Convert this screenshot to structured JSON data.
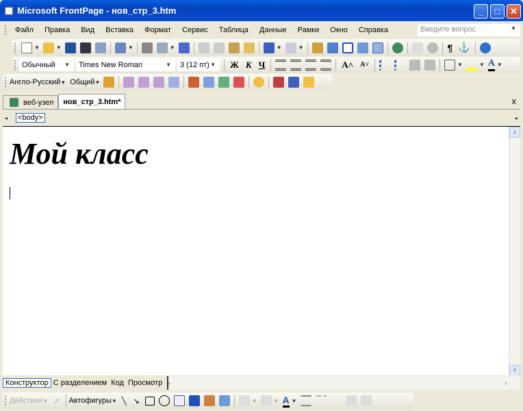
{
  "window": {
    "title": "Microsoft FrontPage - нов_стр_3.htm",
    "minimize": "_",
    "maximize": "□",
    "close": "✕"
  },
  "menu": {
    "items": [
      "Файл",
      "Правка",
      "Вид",
      "Вставка",
      "Формат",
      "Сервис",
      "Таблица",
      "Данные",
      "Рамки",
      "Окно",
      "Справка"
    ],
    "ask_placeholder": "Введите вопрос"
  },
  "formatting": {
    "style": "Обычный",
    "font": "Times New Roman",
    "size": "3 (12 пт)",
    "bold": "Ж",
    "italic": "К",
    "underline": "Ч"
  },
  "toolbar3": {
    "dictionary": "Англо-Русский",
    "general": "Общий"
  },
  "tabs": [
    {
      "label": "веб-узел"
    },
    {
      "label": "нов_стр_3.htm*"
    }
  ],
  "tabs_close": "x",
  "tag_selector": "<body>",
  "document": {
    "heading": "Мой класс"
  },
  "views": [
    "Конструктор",
    "С разделением",
    "Код",
    "Просмотр"
  ],
  "drawing": {
    "actions": "Действия",
    "autoshapes": "Автофигуры"
  },
  "colors": {
    "titlebar": "#0542c0",
    "highlight": "#ffff00",
    "font_color": "#000000"
  }
}
